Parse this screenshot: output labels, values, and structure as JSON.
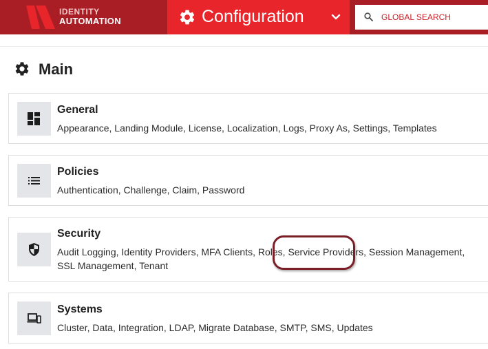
{
  "brand": {
    "line1": "IDENTITY",
    "line2": "AUTOMATION"
  },
  "header": {
    "module_title": "Configuration",
    "search_placeholder": "GLOBAL SEARCH"
  },
  "page": {
    "title": "Main"
  },
  "cards": {
    "general": {
      "title": "General",
      "links": [
        "Appearance",
        "Landing Module",
        "License",
        "Localization",
        "Logs",
        "Proxy As",
        "Settings",
        "Templates"
      ]
    },
    "policies": {
      "title": "Policies",
      "links": [
        "Authentication",
        "Challenge",
        "Claim",
        "Password"
      ]
    },
    "security": {
      "title": "Security",
      "links": [
        "Audit Logging",
        "Identity Providers",
        "MFA Clients",
        "Roles",
        "Service Providers",
        "Session Management",
        "SSL Management",
        "Tenant"
      ]
    },
    "systems": {
      "title": "Systems",
      "links": [
        "Cluster",
        "Data",
        "Integration",
        "LDAP",
        "Migrate Database",
        "SMTP",
        "SMS",
        "Updates"
      ]
    }
  },
  "colors": {
    "topbar": "#a91d24",
    "module_bg": "#e8252b",
    "search_text": "#cc2229",
    "highlight": "#7a1f27"
  },
  "icons": {
    "module": "gear-icon",
    "general": "dashboard-icon",
    "policies": "list-icon",
    "security": "shield-icon",
    "systems": "devices-icon"
  }
}
